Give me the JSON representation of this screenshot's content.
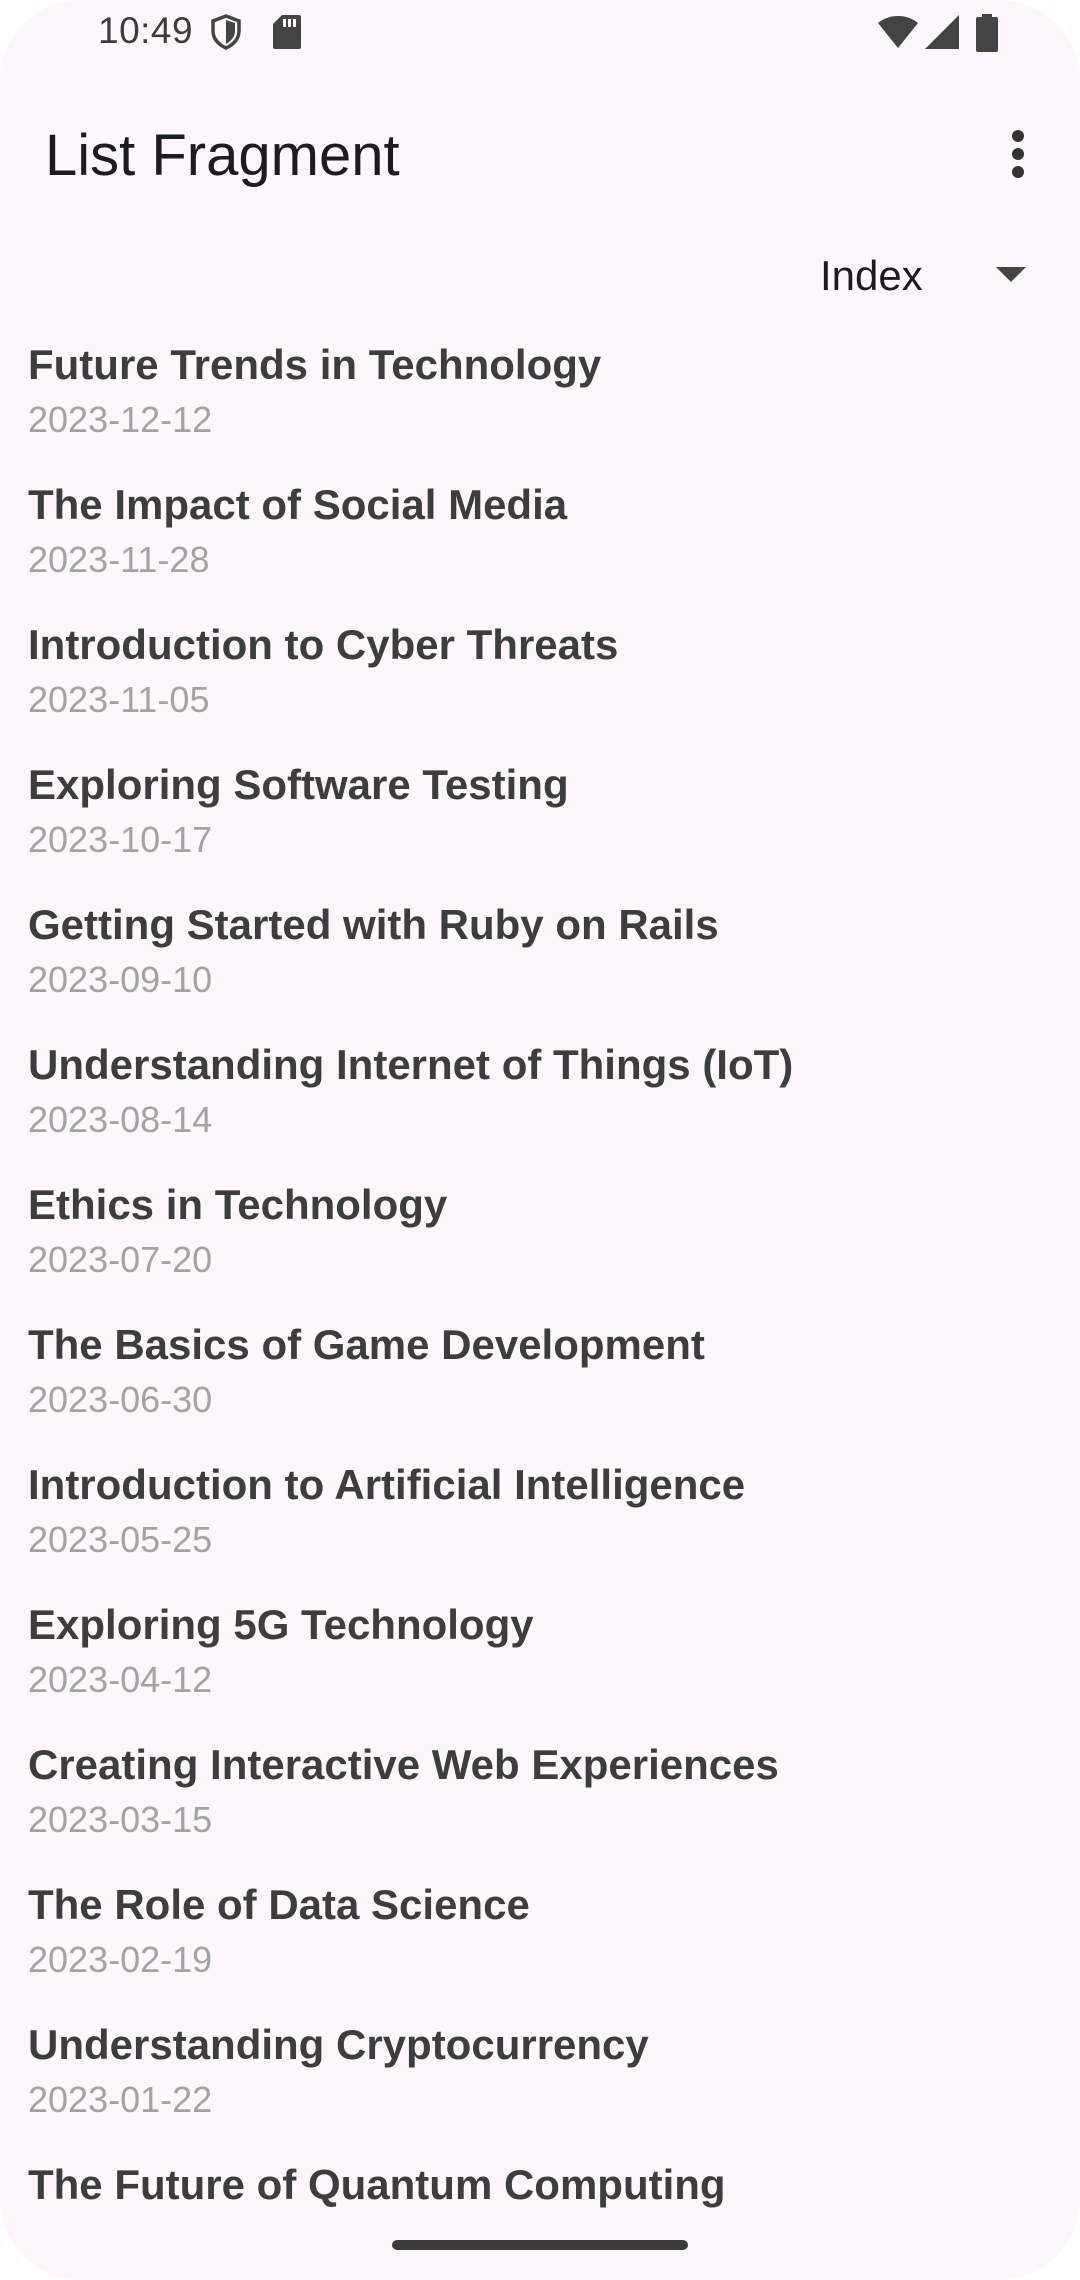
{
  "status_bar": {
    "time": "10:49",
    "icons": [
      "shield-icon",
      "sd-card-icon",
      "wifi-icon",
      "signal-icon",
      "battery-icon"
    ]
  },
  "app_bar": {
    "title": "List Fragment",
    "overflow_icon": "more-vert-icon"
  },
  "sort_spinner": {
    "selected": "Index"
  },
  "items": [
    {
      "title": "Future Trends in Technology",
      "date": "2023-12-12"
    },
    {
      "title": "The Impact of Social Media",
      "date": "2023-11-28"
    },
    {
      "title": "Introduction to Cyber Threats",
      "date": "2023-11-05"
    },
    {
      "title": "Exploring Software Testing",
      "date": "2023-10-17"
    },
    {
      "title": "Getting Started with Ruby on Rails",
      "date": "2023-09-10"
    },
    {
      "title": "Understanding Internet of Things (IoT)",
      "date": "2023-08-14"
    },
    {
      "title": "Ethics in Technology",
      "date": "2023-07-20"
    },
    {
      "title": "The Basics of Game Development",
      "date": "2023-06-30"
    },
    {
      "title": "Introduction to Artificial Intelligence",
      "date": "2023-05-25"
    },
    {
      "title": "Exploring 5G Technology",
      "date": "2023-04-12"
    },
    {
      "title": "Creating Interactive Web Experiences",
      "date": "2023-03-15"
    },
    {
      "title": "The Role of Data Science",
      "date": "2023-02-19"
    },
    {
      "title": "Understanding Cryptocurrency",
      "date": "2023-01-22"
    },
    {
      "title": "The Future of Quantum Computing",
      "date": ""
    }
  ],
  "colors": {
    "background": "#fdf7fc",
    "title_text": "#3d3d3d",
    "date_text": "#a3a3a3",
    "app_title": "#1c1b1f"
  }
}
